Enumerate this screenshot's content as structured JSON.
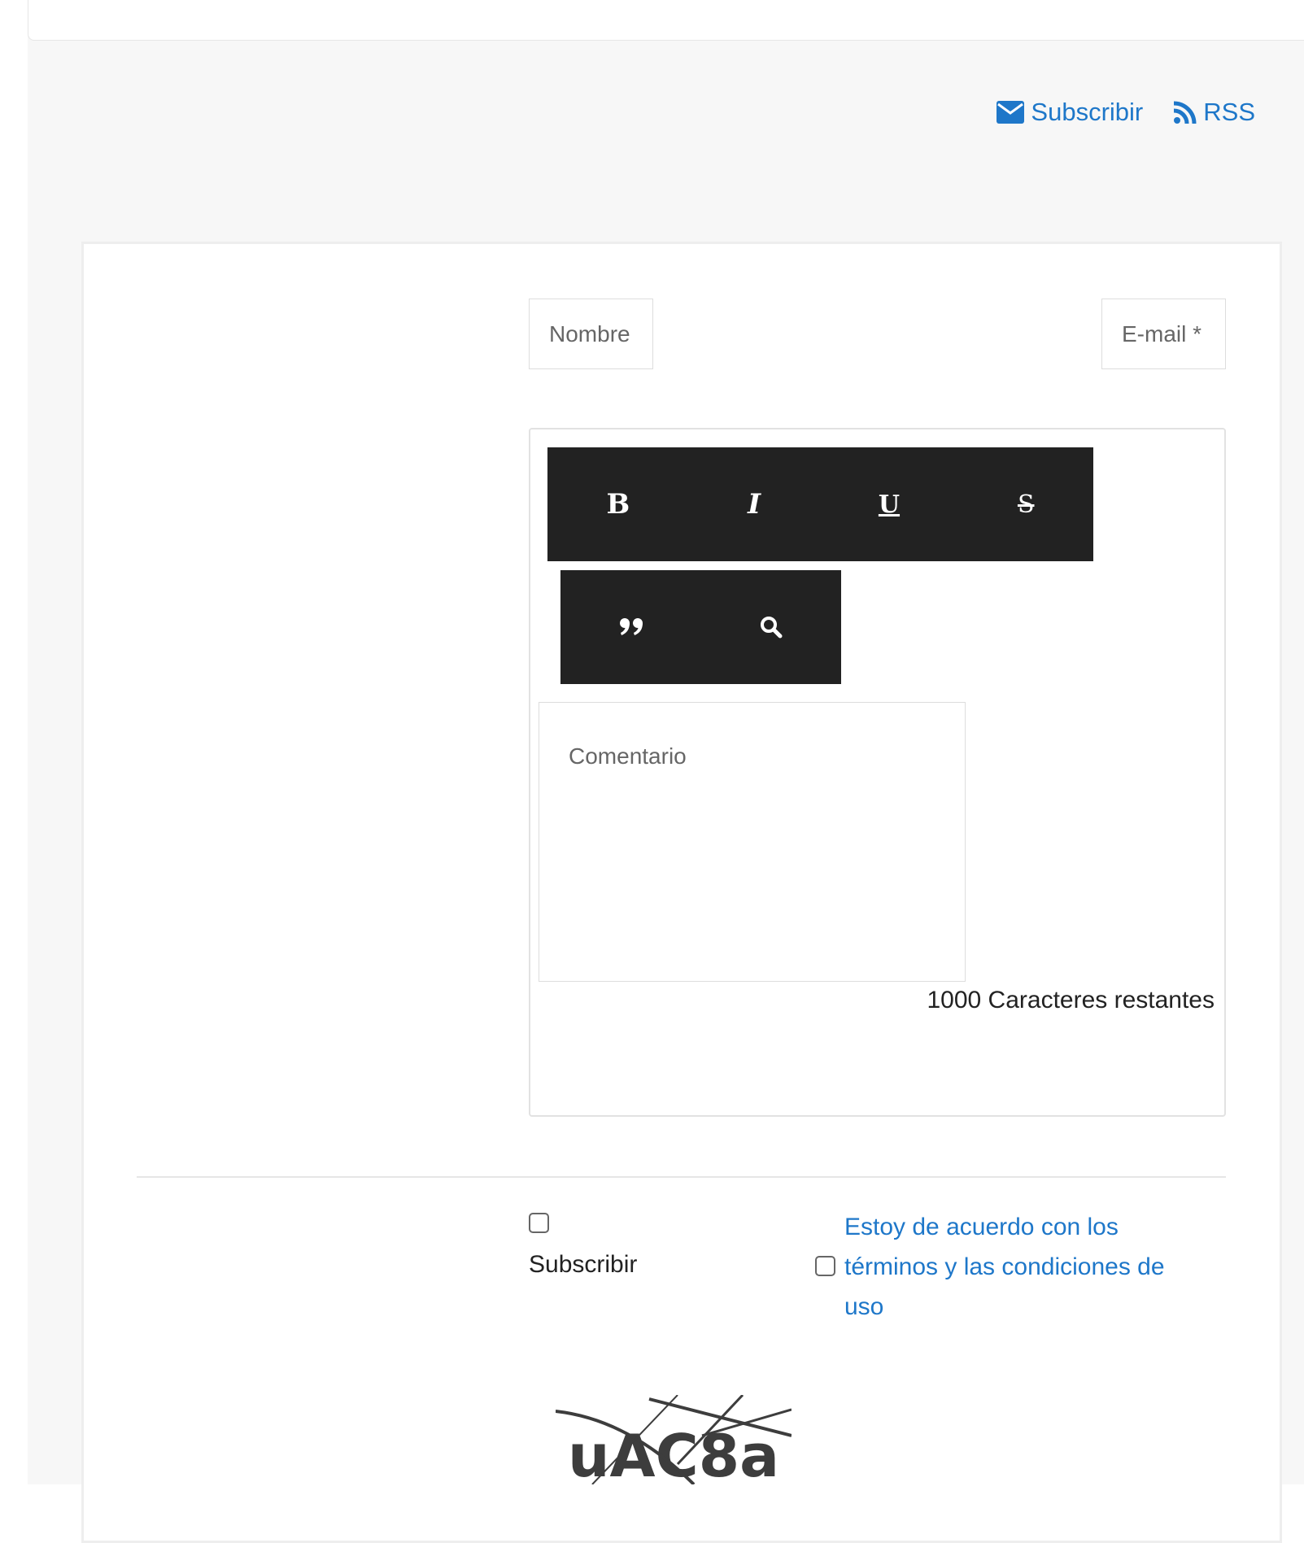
{
  "header_links": {
    "subscribe": "Subscribir",
    "rss": "RSS"
  },
  "form": {
    "name_placeholder": "Nombre",
    "email_placeholder": "E-mail *",
    "toolbar": {
      "bold": "B",
      "italic": "I",
      "underline": "U",
      "strike": "S"
    },
    "comment_placeholder": "Comentario",
    "char_count": "1000 Caracteres restantes",
    "subscribe_label": "Subscribir",
    "terms_label": "Estoy de acuerdo con los términos y las condiciones de uso",
    "captcha_text": "uAC8a"
  },
  "colors": {
    "link": "#1e77c9",
    "toolbar": "#222222"
  }
}
